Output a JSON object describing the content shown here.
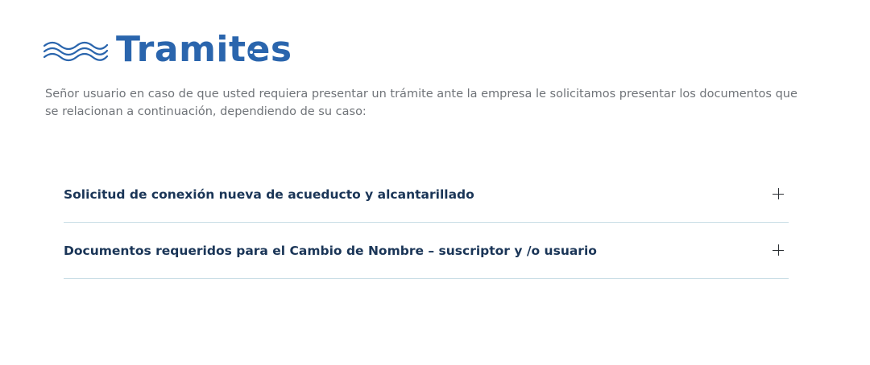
{
  "header": {
    "title": "Tramites",
    "icon": "waves-icon",
    "accent_color": "#2a65ad"
  },
  "intro": {
    "text": "Señor usuario en caso de que usted requiera presentar un trámite ante la empresa le solicitamos presentar los documentos que se relacionan a continuación, dependiendo de su caso:"
  },
  "accordion": {
    "items": [
      {
        "label": "Solicitud de conexión nueva de acueducto y alcantarillado",
        "icon": "plus-icon",
        "expanded": false
      },
      {
        "label": "Documentos requeridos para el Cambio de Nombre – suscriptor y /o usuario",
        "icon": "plus-icon",
        "expanded": false
      }
    ]
  }
}
